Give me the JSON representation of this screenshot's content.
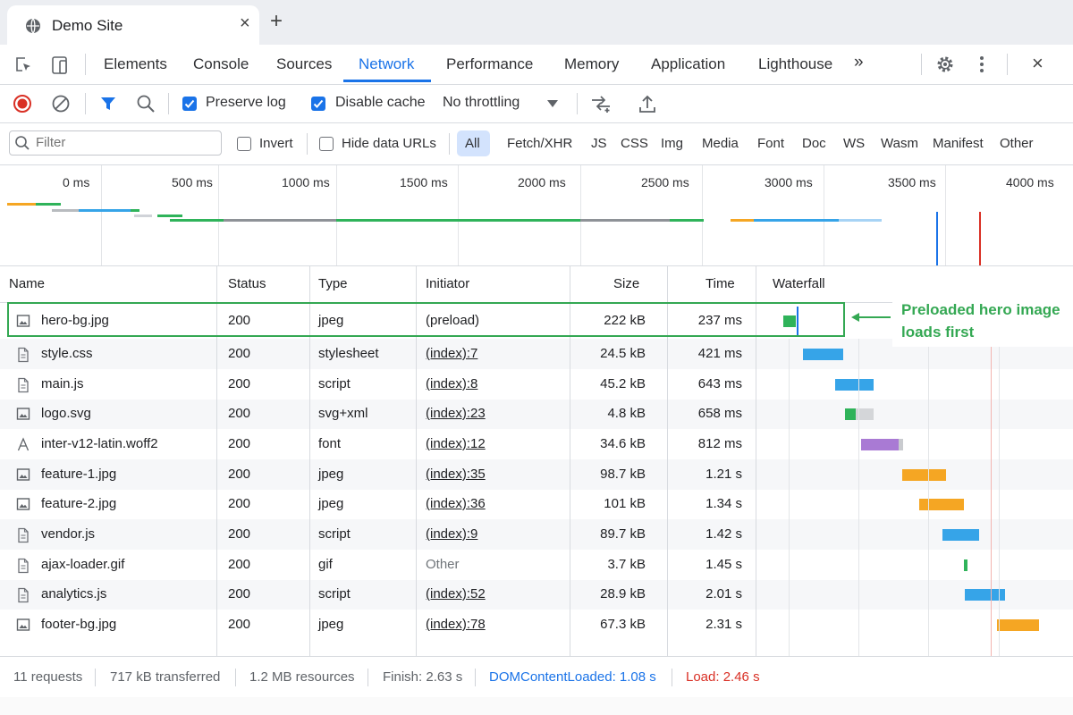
{
  "browser": {
    "tab_title": "Demo Site",
    "close_glyph": "×",
    "new_tab_glyph": "+"
  },
  "devtools": {
    "panel_tabs": [
      "Elements",
      "Console",
      "Sources",
      "Network",
      "Performance",
      "Memory",
      "Application",
      "Lighthouse"
    ],
    "active_tab": "Network",
    "more_tabs_glyph": "»",
    "close_glyph": "×"
  },
  "toolbar": {
    "preserve_log": {
      "label": "Preserve log",
      "checked": true
    },
    "disable_cache": {
      "label": "Disable cache",
      "checked": true
    },
    "throttling": "No throttling"
  },
  "filterbar": {
    "filter_placeholder": "Filter",
    "invert": {
      "label": "Invert",
      "checked": false
    },
    "hide_data_urls": {
      "label": "Hide data URLs",
      "checked": false
    },
    "type_filters": [
      "All",
      "Fetch/XHR",
      "JS",
      "CSS",
      "Img",
      "Media",
      "Font",
      "Doc",
      "WS",
      "Wasm",
      "Manifest",
      "Other"
    ],
    "active_filter": "All"
  },
  "overview": {
    "ticks": [
      "0 ms",
      "500 ms",
      "1000 ms",
      "1500 ms",
      "2000 ms",
      "2500 ms",
      "3000 ms",
      "3500 ms",
      "4000 ms"
    ]
  },
  "table": {
    "columns": [
      "Name",
      "Status",
      "Type",
      "Initiator",
      "Size",
      "Time",
      "Waterfall"
    ],
    "rows": [
      {
        "icon": "image-file-icon",
        "name": "hero-bg.jpg",
        "status": "200",
        "type": "jpeg",
        "initiator": "(preload)",
        "initiator_link": false,
        "size": "222 kB",
        "time": "237 ms"
      },
      {
        "icon": "document-file-icon",
        "name": "style.css",
        "status": "200",
        "type": "stylesheet",
        "initiator": "(index):7",
        "initiator_link": true,
        "size": "24.5 kB",
        "time": "421 ms"
      },
      {
        "icon": "document-file-icon",
        "name": "main.js",
        "status": "200",
        "type": "script",
        "initiator": "(index):8",
        "initiator_link": true,
        "size": "45.2 kB",
        "time": "643 ms"
      },
      {
        "icon": "image-file-icon",
        "name": "logo.svg",
        "status": "200",
        "type": "svg+xml",
        "initiator": "(index):23",
        "initiator_link": true,
        "size": "4.8 kB",
        "time": "658 ms"
      },
      {
        "icon": "font-file-icon",
        "name": "inter-v12-latin.woff2",
        "status": "200",
        "type": "font",
        "initiator": "(index):12",
        "initiator_link": true,
        "size": "34.6 kB",
        "time": "812 ms"
      },
      {
        "icon": "image-file-icon",
        "name": "feature-1.jpg",
        "status": "200",
        "type": "jpeg",
        "initiator": "(index):35",
        "initiator_link": true,
        "size": "98.7 kB",
        "time": "1.21 s"
      },
      {
        "icon": "image-file-icon",
        "name": "feature-2.jpg",
        "status": "200",
        "type": "jpeg",
        "initiator": "(index):36",
        "initiator_link": true,
        "size": "101 kB",
        "time": "1.34 s"
      },
      {
        "icon": "document-file-icon",
        "name": "vendor.js",
        "status": "200",
        "type": "script",
        "initiator": "(index):9",
        "initiator_link": true,
        "size": "89.7 kB",
        "time": "1.42 s"
      },
      {
        "icon": "document-file-icon",
        "name": "ajax-loader.gif",
        "status": "200",
        "type": "gif",
        "initiator": "Other",
        "initiator_link": false,
        "size": "3.7 kB",
        "time": "1.45 s"
      },
      {
        "icon": "document-file-icon",
        "name": "analytics.js",
        "status": "200",
        "type": "script",
        "initiator": "(index):52",
        "initiator_link": true,
        "size": "28.9 kB",
        "time": "2.01 s"
      },
      {
        "icon": "image-file-icon",
        "name": "footer-bg.jpg",
        "status": "200",
        "type": "jpeg",
        "initiator": "(index):78",
        "initiator_link": true,
        "size": "67.3 kB",
        "time": "2.31 s"
      }
    ]
  },
  "annotation": {
    "line1": "Preloaded hero image",
    "line2": "loads first"
  },
  "status": {
    "requests": "11 requests",
    "transferred": "717 kB transferred",
    "resources": "1.2 MB resources",
    "finish": "Finish: 2.63 s",
    "dom_content_loaded": "DOMContentLoaded: 1.08 s",
    "load": "Load: 2.46 s"
  },
  "colors": {
    "accent": "#1a73e8",
    "highlight": "#34a853",
    "load_marker": "#d93025",
    "image_bar": "#f5a623",
    "script_bar": "#36a4e8",
    "font_bar": "#a97ad4",
    "preload_bar": "#2fb35a"
  }
}
